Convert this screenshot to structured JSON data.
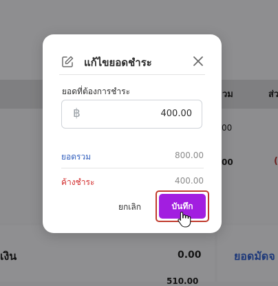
{
  "background": {
    "col_header_1": "วม",
    "col_header_2": "ส่ว",
    "cell_1": "00",
    "cell_2": "00",
    "cell_3": "(",
    "bottom_label": "เงิน",
    "bottom_value": "0.00",
    "bottom_right_title": "ยอดมัดจ",
    "bottom_partial": "510.00"
  },
  "modal": {
    "title": "แก้ไขยอดชำระ",
    "field_label": "ยอดที่ต้องการชำระ",
    "currency_symbol": "฿",
    "amount_value": "400.00",
    "total_label": "ยอดรวม",
    "total_value": "800.00",
    "due_label": "ค้างชำระ",
    "due_value": "400.00",
    "cancel_label": "ยกเลิก",
    "save_label": "บันทึก"
  },
  "colors": {
    "accent": "#a21ee0",
    "total_label": "#2f5dbd",
    "due_label": "#d22a2a",
    "focus_ring": "#c0392b"
  }
}
